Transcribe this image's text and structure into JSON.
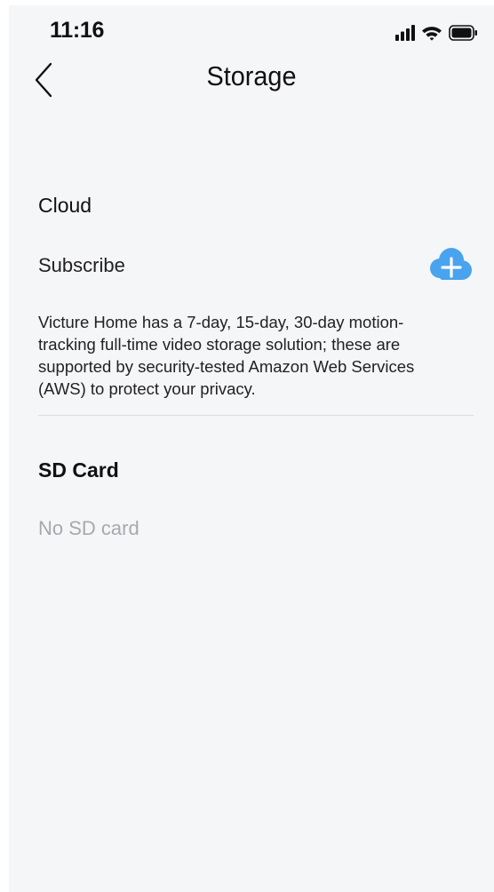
{
  "status_bar": {
    "time": "11:16",
    "icons": [
      "cellular-signal-icon",
      "wifi-icon",
      "battery-icon"
    ]
  },
  "header": {
    "back_icon": "chevron-left-icon",
    "title": "Storage"
  },
  "cloud": {
    "section_title": "Cloud",
    "subscribe_label": "Subscribe",
    "subscribe_icon": "cloud-plus-icon",
    "description": "Victure Home has a 7-day, 15-day, 30-day motion-tracking full-time video storage solution; these are supported by security-tested Amazon Web Services (AWS) to protect your privacy."
  },
  "sd_card": {
    "section_title": "SD Card",
    "status": "No SD card"
  },
  "colors": {
    "background": "#f5f6f8",
    "accent": "#4aa3ef",
    "text": "#111111",
    "muted": "#a7a9ad"
  }
}
